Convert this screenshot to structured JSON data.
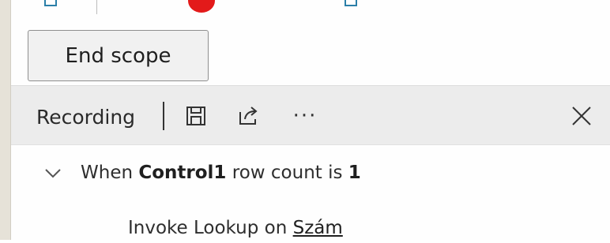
{
  "end_scope": {
    "label": "End scope"
  },
  "recording": {
    "label": "Recording",
    "icons": [
      "save-icon",
      "share-icon",
      "more-icon",
      "close-icon"
    ],
    "more_glyph": "···"
  },
  "tree": {
    "row1": {
      "prefix": "When ",
      "control": "Control1",
      "middle": " row count is ",
      "count": "1"
    },
    "row2": {
      "prefix": "Invoke Lookup on ",
      "target": "Szám"
    }
  },
  "colors": {
    "accent_red": "#e31a1a",
    "checkbox_blue": "#2b7fa8",
    "bar_bg": "#ececec",
    "button_bg": "#f1f1f1"
  }
}
